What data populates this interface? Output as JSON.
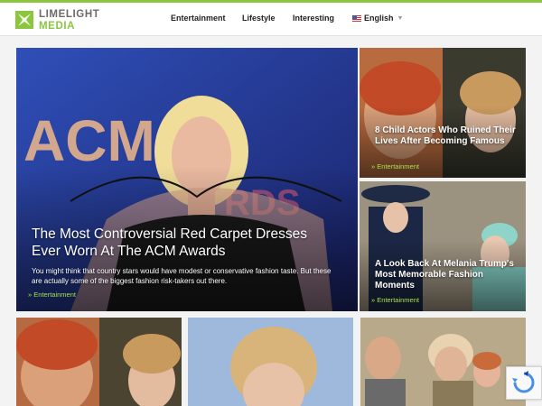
{
  "brand": {
    "line1": "LIMELIGHT",
    "line2": "MEDIA",
    "accent": "#8cc63f"
  },
  "nav": {
    "entertainment": "Entertainment",
    "lifestyle": "Lifestyle",
    "interesting": "Interesting",
    "language": "English"
  },
  "featured": {
    "title": "The Most Controversial Red Carpet Dresses Ever Worn At The ACM Awards",
    "description": "You might think that country stars would have modest or conservative fashion taste. But these are actually some of the biggest fashion risk-takers out there.",
    "category": "Entertainment",
    "backdrop_text": "ACM"
  },
  "side_cards": [
    {
      "title": "8 Child Actors Who Ruined Their Lives After Becoming Famous",
      "category": "Entertainment"
    },
    {
      "title": "A Look Back At Melania Trump's Most Memorable Fashion Moments",
      "category": "Entertainment"
    }
  ],
  "icons": [
    "logo-mark-icon",
    "us-flag-icon",
    "chevron-down-icon",
    "recaptcha-icon"
  ]
}
